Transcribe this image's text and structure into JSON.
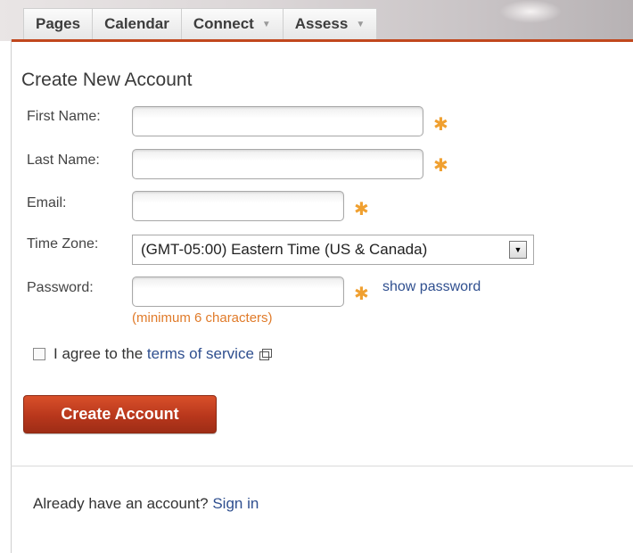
{
  "nav": {
    "tabs": [
      {
        "label": "Pages",
        "has_dropdown": false
      },
      {
        "label": "Calendar",
        "has_dropdown": false
      },
      {
        "label": "Connect",
        "has_dropdown": true
      },
      {
        "label": "Assess",
        "has_dropdown": true
      }
    ]
  },
  "form": {
    "title": "Create New Account",
    "first_name_label": "First Name:",
    "first_name_value": "",
    "last_name_label": "Last Name:",
    "last_name_value": "",
    "email_label": "Email:",
    "email_value": "",
    "timezone_label": "Time Zone:",
    "timezone_value": "(GMT-05:00) Eastern Time (US & Canada)",
    "password_label": "Password:",
    "password_value": "",
    "show_password_link": "show password",
    "password_hint": "(minimum 6 characters)",
    "required_marker": "✱",
    "agree_prefix": "I agree to the",
    "agree_link": "terms of service",
    "agree_checked": false,
    "submit_label": "Create Account"
  },
  "footer": {
    "prompt": "Already have an account?",
    "signin_link": "Sign in"
  },
  "colors": {
    "accent": "#c1471d",
    "required": "#f0a030",
    "link": "#2f4f8f",
    "hint": "#e07b2a"
  },
  "icons": {
    "dropdown_caret": "chevron-down-icon",
    "select_arrow": "select-arrow-icon",
    "external_link": "external-link-icon",
    "required": "required-asterisk-icon"
  }
}
